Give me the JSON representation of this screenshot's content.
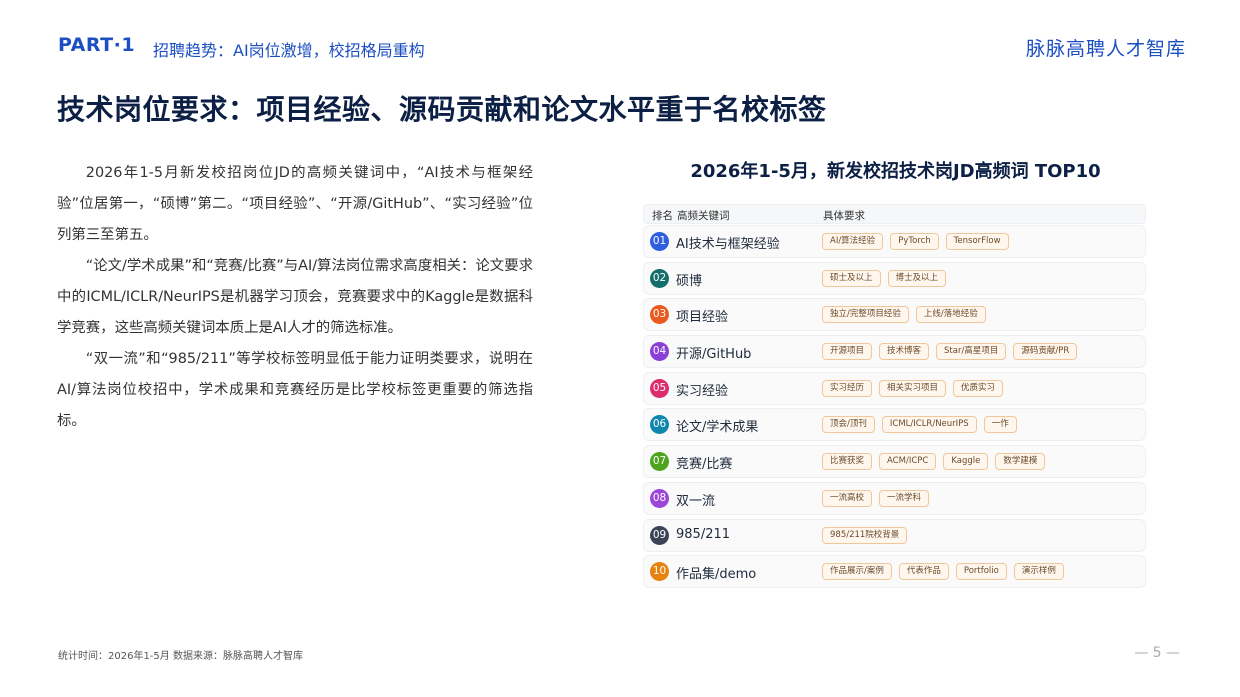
{
  "header": {
    "part": "PART·1",
    "subtitle": "招聘趋势：AI岗位激增，校招格局重构",
    "brand": "脉脉高聘人才智库"
  },
  "title": "技术岗位要求：项目经验、源码贡献和论文水平重于名校标签",
  "paragraphs": [
    "2026年1-5月新发校招岗位JD的高频关键词中，“AI技术与框架经验”位居第一，“硕博”第二。“项目经验”、“开源/GitHub”、“实习经验”位列第三至第五。",
    "“论文/学术成果”和“竞赛/比赛”与AI/算法岗位需求高度相关：论文要求中的ICML/ICLR/NeurIPS是机器学习顶会，竞赛要求中的Kaggle是数据科学竞赛，这些高频关键词本质上是AI人才的筛选标准。",
    "“双一流”和“985/211”等学校标签明显低于能力证明类要求，说明在AI/算法岗位校招中，学术成果和竞赛经历是比学校标签更重要的筛选指标。"
  ],
  "table": {
    "title": "2026年1-5月，新发校招技术岗JD高频词 TOP10",
    "headers": {
      "rank": "排名",
      "keyword": "高频关键词",
      "requirements": "具体要求"
    },
    "rows": [
      {
        "rank": "01",
        "keyword": "AI技术与框架经验",
        "color": "#2f5ee0",
        "tags": [
          "AI/算法经验",
          "PyTorch",
          "TensorFlow"
        ]
      },
      {
        "rank": "02",
        "keyword": "硕博",
        "color": "#136f6a",
        "tags": [
          "硕士及以上",
          "博士及以上"
        ]
      },
      {
        "rank": "03",
        "keyword": "项目经验",
        "color": "#ea5a1e",
        "tags": [
          "独立/完整项目经验",
          "上线/落地经验"
        ]
      },
      {
        "rank": "04",
        "keyword": "开源/GitHub",
        "color": "#8a3fd6",
        "tags": [
          "开源项目",
          "技术博客",
          "Star/高星项目",
          "源码贡献/PR"
        ]
      },
      {
        "rank": "05",
        "keyword": "实习经验",
        "color": "#de2b6b",
        "tags": [
          "实习经历",
          "相关实习项目",
          "优质实习"
        ]
      },
      {
        "rank": "06",
        "keyword": "论文/学术成果",
        "color": "#0e86ad",
        "tags": [
          "顶会/顶刊",
          "ICML/ICLR/NeurIPS",
          "一作"
        ]
      },
      {
        "rank": "07",
        "keyword": "竞赛/比赛",
        "color": "#4ea41f",
        "tags": [
          "比赛获奖",
          "ACM/ICPC",
          "Kaggle",
          "数学建模"
        ]
      },
      {
        "rank": "08",
        "keyword": "双一流",
        "color": "#9a46d6",
        "tags": [
          "一流高校",
          "一流学科"
        ]
      },
      {
        "rank": "09",
        "keyword": "985/211",
        "color": "#3b4456",
        "tags": [
          "985/211院校背景"
        ]
      },
      {
        "rank": "10",
        "keyword": "作品集/demo",
        "color": "#e6830f",
        "tags": [
          "作品展示/案例",
          "代表作品",
          "Portfolio",
          "演示样例"
        ]
      }
    ]
  },
  "footer": {
    "source": "统计时间：2026年1-5月    数据来源：脉脉高聘人才智库",
    "page": "— 5 —"
  }
}
